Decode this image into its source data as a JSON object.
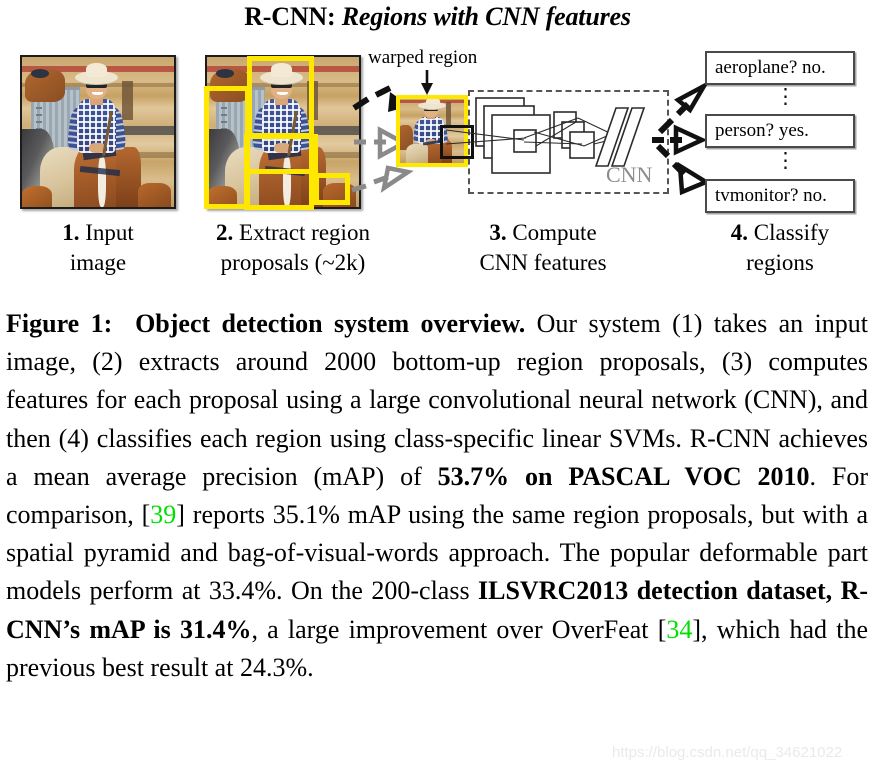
{
  "title": {
    "prefix": "R-CNN:",
    "italic": " Regions with CNN features"
  },
  "figure": {
    "warped_label": "warped region",
    "cnn_label": "CNN",
    "classify_boxes": [
      {
        "text": "aeroplane? no."
      },
      {
        "text": "person? yes."
      },
      {
        "text": "tvmonitor? no."
      }
    ],
    "dots": "⋮",
    "steps": [
      {
        "num": "1.",
        "line1": " Input",
        "line2": "image"
      },
      {
        "num": "2.",
        "line1": " Extract region",
        "line2": "proposals (~2k)"
      },
      {
        "num": "3.",
        "line1": " Compute",
        "line2": "CNN features"
      },
      {
        "num": "4.",
        "line1": " Classify",
        "line2": "regions"
      }
    ]
  },
  "caption": {
    "label": "Figure 1:",
    "heading": "Object detection system overview.",
    "t1": " Our system (1) takes an input image, (2) extracts around 2000 bottom-up region proposals, (3) computes features for each proposal using a large convolutional neural network (CNN), and then (4) classifies each region using class-specific linear SVMs. R-CNN achieves a mean average precision (mAP) of ",
    "b1": "53.7% on PASCAL VOC 2010",
    "t2": ". For comparison, [",
    "cite1": "39",
    "t3": "] reports 35.1% mAP using the same region proposals, but with a spatial pyramid and bag-of-visual-words approach. The popular deformable part models perform at 33.4%. On the 200-class ",
    "b2": "ILSVRC2013 detection dataset, R-CNN’s mAP is 31.4%",
    "t4": ", a large improvement over OverFeat [",
    "cite2": "34",
    "t5": "], which had the previous best result at 24.3%."
  },
  "watermark": {
    "text": "https://blog.csdn.net/qq_34621022"
  },
  "colors": {
    "proposal_box": "#ffe800",
    "citation_green": "#00e000",
    "cnn_gray": "#8c8c8c",
    "arrow_black": "#111111",
    "arrow_gray": "#8a8a8a"
  }
}
